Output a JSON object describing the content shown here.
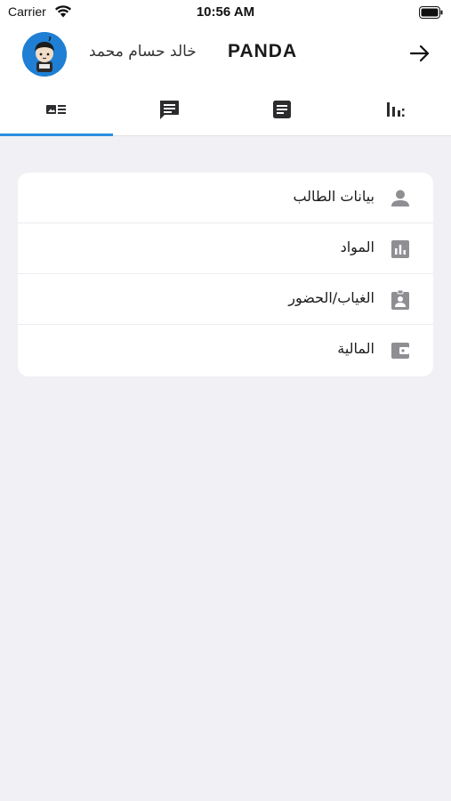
{
  "status_bar": {
    "carrier": "Carrier",
    "time": "10:56 AM"
  },
  "header": {
    "user_name": "خالد حسام محمد",
    "brand": "PANDA",
    "avatar_color": "#1f7fd4",
    "forward_icon": "arrow-right-icon"
  },
  "tabs": [
    {
      "icon": "id-card-icon",
      "active": true
    },
    {
      "icon": "message-icon",
      "active": false
    },
    {
      "icon": "document-icon",
      "active": false
    },
    {
      "icon": "bar-chart-icon",
      "active": false
    }
  ],
  "menu": [
    {
      "label": "بيانات الطالب",
      "icon": "person-icon"
    },
    {
      "label": "المواد",
      "icon": "chart-box-icon"
    },
    {
      "label": "الغياب/الحضور",
      "icon": "badge-clipboard-icon"
    },
    {
      "label": "المالية",
      "icon": "wallet-icon"
    }
  ],
  "colors": {
    "accent": "#2b8fe0",
    "background": "#f0f0f5",
    "icon_gray": "#8e8e93",
    "tab_icon": "#2c2c2e"
  }
}
